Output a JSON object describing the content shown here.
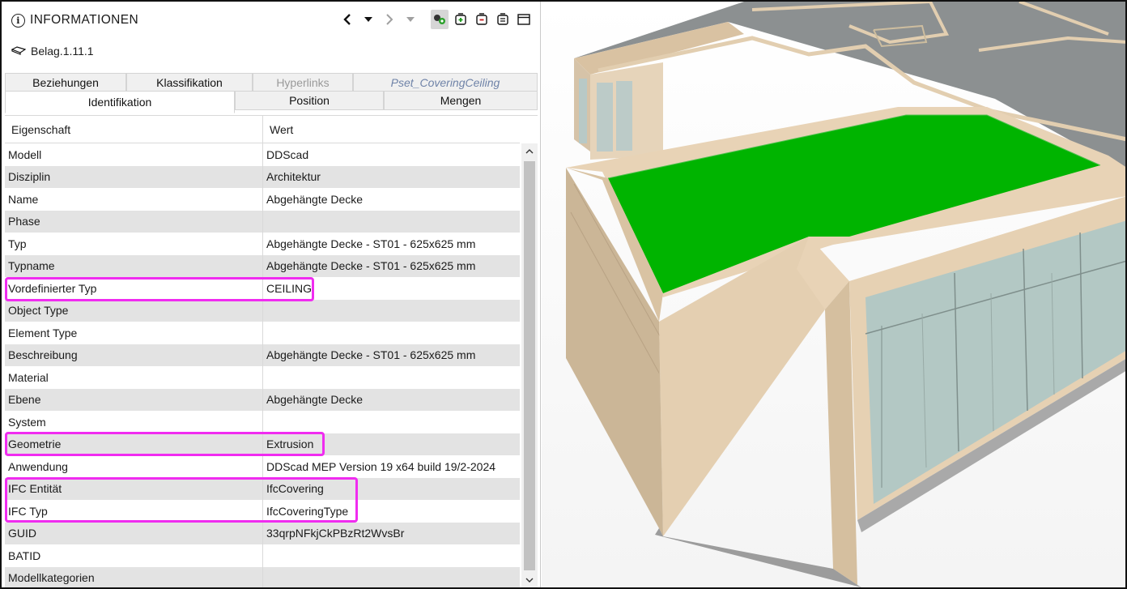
{
  "panel": {
    "title": "INFORMATIONEN",
    "element_name": "Belag.1.11.1"
  },
  "tabs": {
    "row1": [
      "Beziehungen",
      "Klassifikation",
      "Hyperlinks",
      "Pset_CoveringCeiling"
    ],
    "row2": [
      "Identifikation",
      "Position",
      "Mengen"
    ]
  },
  "table": {
    "headers": [
      "Eigenschaft",
      "Wert"
    ],
    "rows": [
      {
        "property": "Modell",
        "value": "DDScad"
      },
      {
        "property": "Disziplin",
        "value": "Architektur"
      },
      {
        "property": "Name",
        "value": "Abgehängte Decke"
      },
      {
        "property": "Phase",
        "value": ""
      },
      {
        "property": "Typ",
        "value": "Abgehängte Decke - ST01 - 625x625 mm"
      },
      {
        "property": "Typname",
        "value": "Abgehängte Decke - ST01 - 625x625 mm"
      },
      {
        "property": "Vordefinierter Typ",
        "value": "CEILING"
      },
      {
        "property": "Object Type",
        "value": ""
      },
      {
        "property": "Element Type",
        "value": ""
      },
      {
        "property": "Beschreibung",
        "value": "Abgehängte Decke - ST01 - 625x625 mm"
      },
      {
        "property": "Material",
        "value": ""
      },
      {
        "property": "Ebene",
        "value": "Abgehängte Decke"
      },
      {
        "property": "System",
        "value": ""
      },
      {
        "property": "Geometrie",
        "value": "Extrusion"
      },
      {
        "property": "Anwendung",
        "value": "DDScad MEP Version 19 x64 build 19/2-2024"
      },
      {
        "property": "IFC Entität",
        "value": "IfcCovering"
      },
      {
        "property": "IFC Typ",
        "value": "IfcCoveringType"
      },
      {
        "property": "GUID",
        "value": "33qrpNFkjCkPBzRt2WvsBr"
      },
      {
        "property": "BATID",
        "value": ""
      },
      {
        "property": "Modellkategorien",
        "value": ""
      }
    ]
  },
  "colors": {
    "highlight": "#f02cf0",
    "selected_ceiling": "#00b400",
    "wall_beige": "#e8d3b6",
    "roof_gray": "#8c9091",
    "glass": "#b3c8c4"
  }
}
